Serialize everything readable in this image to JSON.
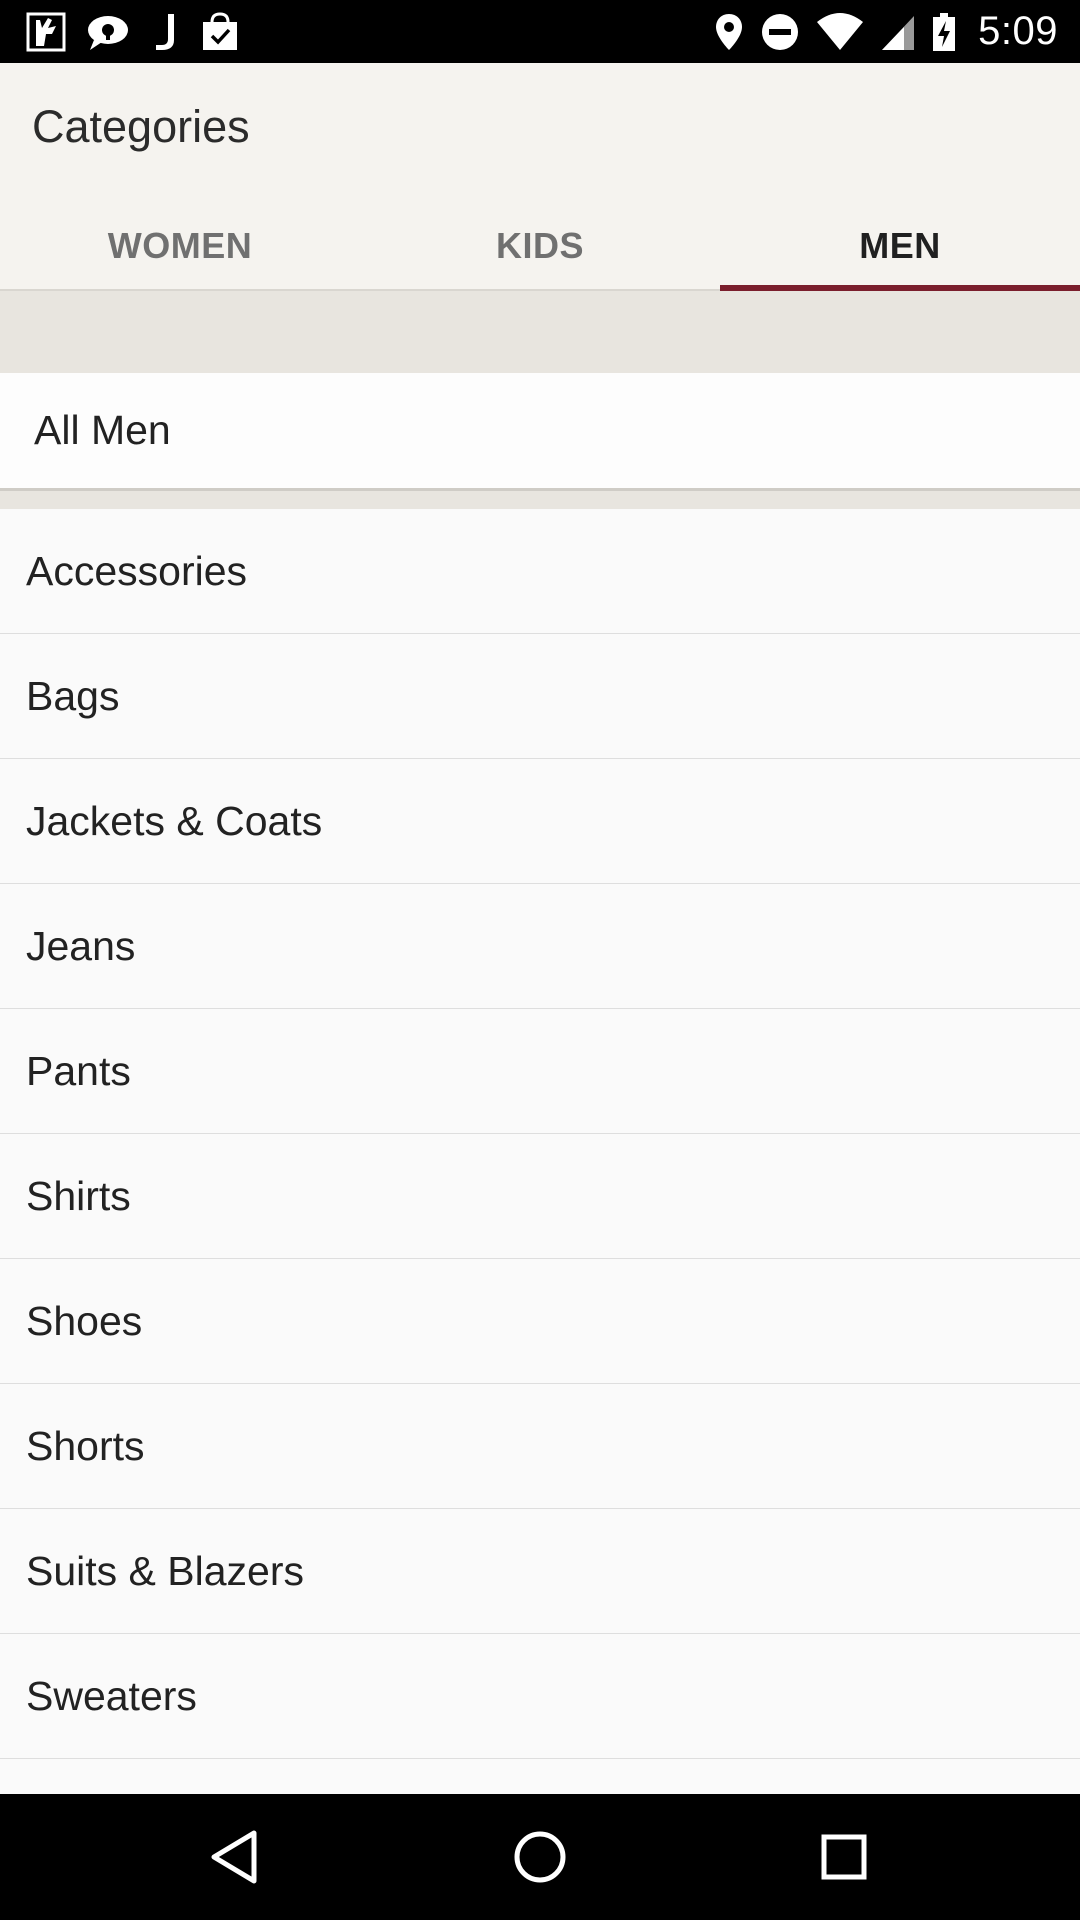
{
  "status_bar": {
    "time": "5:09",
    "left_icons": [
      "app-notification-icon",
      "chat-icon",
      "j-app-icon",
      "shopping-bag-icon"
    ],
    "right_icons": [
      "location-icon",
      "do-not-disturb-icon",
      "wifi-icon",
      "cell-signal-icon",
      "battery-charging-icon"
    ]
  },
  "app_bar": {
    "title": "Categories"
  },
  "tabs": [
    {
      "label": "WOMEN",
      "active": false
    },
    {
      "label": "KIDS",
      "active": false
    },
    {
      "label": "MEN",
      "active": true
    }
  ],
  "all_item": {
    "label": "All Men"
  },
  "categories": [
    "Accessories",
    "Bags",
    "Jackets & Coats",
    "Jeans",
    "Pants",
    "Shirts",
    "Shoes",
    "Shorts",
    "Suits & Blazers",
    "Sweaters"
  ],
  "nav_bar": {
    "buttons": [
      "back-icon",
      "home-icon",
      "recents-icon"
    ]
  },
  "colors": {
    "accent": "#7a1e2c",
    "app_bar_bg": "#f5f3ef",
    "band_bg": "#e8e5df"
  }
}
